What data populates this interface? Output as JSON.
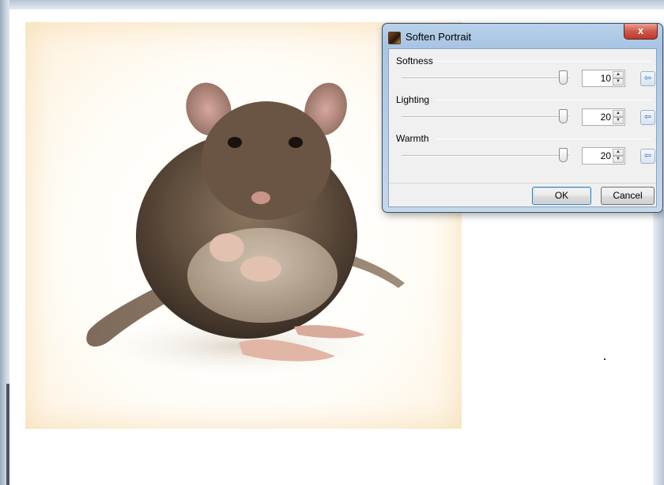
{
  "dialog": {
    "title": "Soften Portrait",
    "close_label": "x",
    "ok_label": "OK",
    "cancel_label": "Cancel",
    "sliders": [
      {
        "label": "Softness",
        "value": "10",
        "level": 0.99
      },
      {
        "label": "Lighting",
        "value": "20",
        "level": 0.99
      },
      {
        "label": "Warmth",
        "value": "20",
        "level": 0.99
      }
    ],
    "spin_up_icon": "▲",
    "spin_down_icon": "▼",
    "reset_icon": "⇦"
  },
  "icons": {
    "title_icon": "soften-portrait-icon",
    "close_icon": "close-icon",
    "reset_icon": "reset-arrow-icon"
  },
  "colors": {
    "title_bar": "#a8c5e3",
    "close_button": "#c7473a",
    "client_bg": "#f0f0f0",
    "photo_bg": "#fffdf8"
  }
}
